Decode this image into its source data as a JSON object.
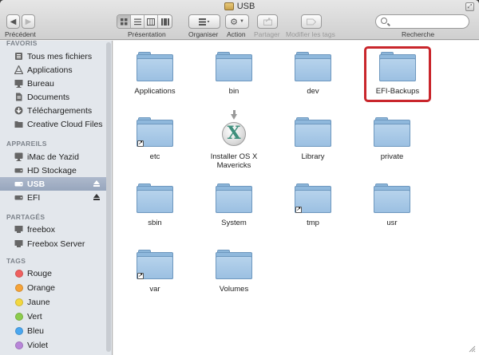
{
  "window": {
    "title": "USB"
  },
  "toolbar": {
    "back_label": "Précédent",
    "presentation_label": "Présentation",
    "organize_label": "Organiser",
    "action_label": "Action",
    "share_label": "Partager",
    "edit_tags_label": "Modifier les tags",
    "search_label": "Recherche",
    "search_value": ""
  },
  "sidebar": {
    "favorites_header": "FAVORIS",
    "favorites": [
      {
        "label": "Tous mes fichiers",
        "icon": "all-files-icon"
      },
      {
        "label": "Applications",
        "icon": "applications-icon"
      },
      {
        "label": "Bureau",
        "icon": "desktop-icon"
      },
      {
        "label": "Documents",
        "icon": "documents-icon"
      },
      {
        "label": "Téléchargements",
        "icon": "downloads-icon"
      },
      {
        "label": "Creative Cloud Files",
        "icon": "folder-icon"
      }
    ],
    "devices_header": "APPAREILS",
    "devices": [
      {
        "label": "iMac de Yazid",
        "icon": "imac-icon"
      },
      {
        "label": "HD Stockage",
        "icon": "hard-drive-icon"
      },
      {
        "label": "USB",
        "icon": "usb-drive-icon",
        "selected": true,
        "eject": true
      },
      {
        "label": "EFI",
        "icon": "drive-icon",
        "eject": true
      }
    ],
    "shared_header": "PARTAGÉS",
    "shared": [
      {
        "label": "freebox",
        "icon": "server-icon"
      },
      {
        "label": "Freebox Server",
        "icon": "server-icon"
      }
    ],
    "tags_header": "TAGS",
    "tags": [
      {
        "label": "Rouge",
        "color": "#f0605f"
      },
      {
        "label": "Orange",
        "color": "#f6a338"
      },
      {
        "label": "Jaune",
        "color": "#f3d840"
      },
      {
        "label": "Vert",
        "color": "#8ccc4d"
      },
      {
        "label": "Bleu",
        "color": "#4aa7f0"
      },
      {
        "label": "Violet",
        "color": "#b886d9"
      }
    ]
  },
  "content": {
    "items": [
      {
        "label": "Applications",
        "kind": "folder",
        "alias": false
      },
      {
        "label": "bin",
        "kind": "folder",
        "alias": false
      },
      {
        "label": "dev",
        "kind": "folder",
        "alias": false
      },
      {
        "label": "EFI-Backups",
        "kind": "folder",
        "alias": false,
        "highlighted": true
      },
      {
        "label": "etc",
        "kind": "folder",
        "alias": true
      },
      {
        "label": "Installer OS X Mavericks",
        "kind": "installer",
        "alias": false
      },
      {
        "label": "Library",
        "kind": "folder",
        "alias": false
      },
      {
        "label": "private",
        "kind": "folder",
        "alias": false
      },
      {
        "label": "sbin",
        "kind": "folder",
        "alias": false
      },
      {
        "label": "System",
        "kind": "folder",
        "alias": false
      },
      {
        "label": "tmp",
        "kind": "folder",
        "alias": true
      },
      {
        "label": "usr",
        "kind": "folder",
        "alias": false
      },
      {
        "label": "var",
        "kind": "folder",
        "alias": true
      },
      {
        "label": "Volumes",
        "kind": "folder",
        "alias": false
      }
    ]
  },
  "colors": {
    "highlight_border": "#c9262c",
    "selection": "#97a6bd",
    "folder_blue": "#9cc0e2"
  }
}
